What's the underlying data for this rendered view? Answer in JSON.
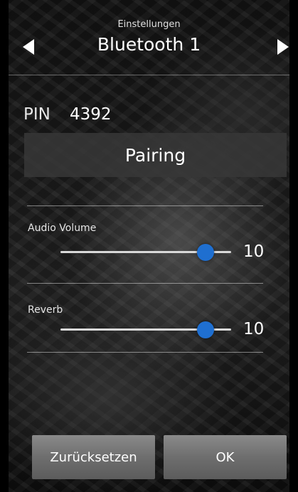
{
  "header": {
    "subtitle": "Einstellungen",
    "title": "Bluetooth 1"
  },
  "pin": {
    "label": "PIN",
    "value": "4392"
  },
  "pairing_button": "Pairing",
  "sliders": [
    {
      "label": "Audio Volume",
      "value": "10",
      "level": 0.85
    },
    {
      "label": "Reverb",
      "value": "10",
      "level": 0.85
    }
  ],
  "buttons": {
    "reset": "Zurücksetzen",
    "ok": "OK"
  },
  "colors": {
    "accent": "#1f6fd0"
  },
  "icons": {
    "prev": "triangle-left-icon",
    "next": "triangle-right-icon"
  }
}
